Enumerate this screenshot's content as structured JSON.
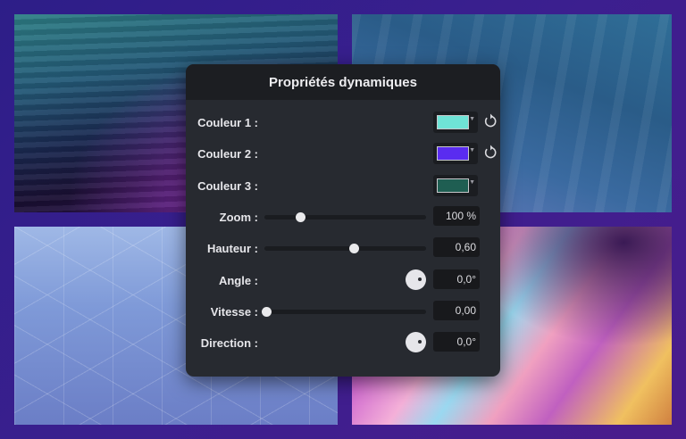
{
  "panel": {
    "title": "Propriétés dynamiques",
    "colors": [
      {
        "label": "Couleur 1 :",
        "value": "#6fe3d6",
        "resettable": true
      },
      {
        "label": "Couleur 2 :",
        "value": "#5a2cf0",
        "resettable": true
      },
      {
        "label": "Couleur 3 :",
        "value": "#1f5e52",
        "resettable": false
      }
    ],
    "sliders": [
      {
        "label": "Zoom :",
        "value_text": "100 %",
        "level": 0.22
      },
      {
        "label": "Hauteur :",
        "value_text": "0,60",
        "level": 0.55
      },
      {
        "label": "Vitesse :",
        "value_text": "0,00",
        "level": 0.01
      }
    ],
    "dials": [
      {
        "label": "Angle :",
        "value_text": "0,0°"
      },
      {
        "label": "Direction :",
        "value_text": "0,0°"
      }
    ]
  },
  "icons": {
    "reset": "reset-arrow-icon",
    "dropdown": "dropdown-caret-icon",
    "dial": "rotation-dial-icon"
  },
  "colors": {
    "panel_bg": "#272a30",
    "panel_header": "#1c1e22",
    "page_bg": "#3a1d8a"
  }
}
